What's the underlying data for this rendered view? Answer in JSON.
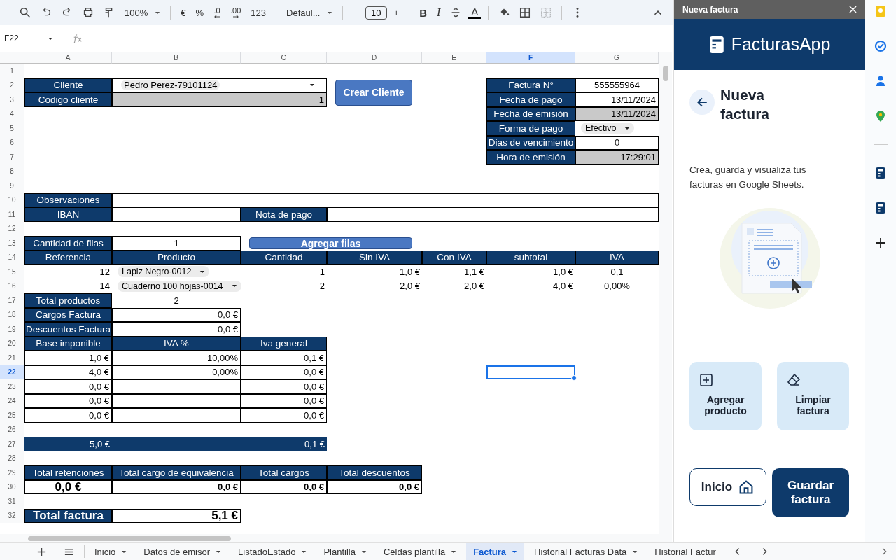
{
  "toolbar": [
    [
      {
        "kind": "search"
      },
      {
        "kind": "undo"
      },
      {
        "kind": "redo"
      },
      {
        "kind": "print"
      },
      {
        "kind": "paint-format"
      },
      {
        "kind": "dropdown",
        "text": "100%"
      }
    ],
    [
      {
        "kind": "text",
        "text": "€"
      },
      {
        "kind": "text",
        "text": "%"
      },
      {
        "kind": "decimal-less",
        "text": ".0"
      },
      {
        "kind": "decimal-more",
        "text": ".00"
      },
      {
        "kind": "text",
        "text": "123"
      }
    ],
    [
      {
        "kind": "dropdown",
        "text": "Defaul..."
      }
    ],
    [
      {
        "kind": "text",
        "text": "−"
      },
      {
        "kind": "field",
        "text": "10"
      },
      {
        "kind": "text",
        "text": "+"
      }
    ],
    [
      {
        "kind": "bold",
        "text": "B"
      },
      {
        "kind": "italic",
        "text": "I"
      },
      {
        "kind": "strikethrough"
      },
      {
        "kind": "text-color",
        "text": "A"
      }
    ],
    [
      {
        "kind": "fill-color"
      },
      {
        "kind": "borders"
      },
      {
        "kind": "merge",
        "disabled": true
      }
    ],
    [
      {
        "kind": "more"
      }
    ]
  ],
  "name_box": "F22",
  "sheet": {
    "columns": [
      "A",
      "B",
      "C",
      "D",
      "E",
      "F",
      "G"
    ],
    "row_numbers": [
      "1",
      "2",
      "3",
      "4",
      "5",
      "6",
      "7",
      "8",
      "9",
      "10",
      "11",
      "12",
      "13",
      "14",
      "15",
      "16",
      "17",
      "18",
      "19",
      "20",
      "21",
      "22",
      "23",
      "24",
      "25",
      "26",
      "27",
      "28",
      "29",
      "30",
      "31",
      "32"
    ],
    "cells": [
      {
        "kind": "label",
        "text": "Cliente"
      },
      {
        "kind": "dropdown",
        "text": "Pedro Perez-79101124"
      },
      {
        "kind": "button",
        "text": "Crear Cliente"
      },
      {
        "kind": "label",
        "text": "Factura N°"
      },
      {
        "kind": "value",
        "text": "555555964"
      },
      {
        "kind": "label",
        "text": "Codigo cliente"
      },
      {
        "kind": "readonly",
        "text": "1"
      },
      {
        "kind": "label",
        "text": "Fecha de pago"
      },
      {
        "kind": "value",
        "text": "13/11/2024"
      },
      {
        "kind": "label",
        "text": "Fecha de emisión"
      },
      {
        "kind": "readonly",
        "text": "13/11/2024"
      },
      {
        "kind": "label",
        "text": "Forma de pago"
      },
      {
        "kind": "chip",
        "text": "Efectivo"
      },
      {
        "kind": "label",
        "text": "Dias de vencimiento"
      },
      {
        "kind": "value",
        "text": "0"
      },
      {
        "kind": "label",
        "text": "Hora de emisión"
      },
      {
        "kind": "readonly",
        "text": "17:29:01"
      },
      {
        "kind": "label",
        "text": "Observaciones"
      },
      {
        "kind": "value"
      },
      {
        "kind": "label",
        "text": "IBAN"
      },
      {
        "kind": "value"
      },
      {
        "kind": "label",
        "text": "Nota de pago"
      },
      {
        "kind": "value"
      },
      {
        "kind": "label",
        "text": "Cantidad de filas"
      },
      {
        "kind": "value",
        "text": "1"
      },
      {
        "kind": "button",
        "text": "Agregar filas"
      },
      {
        "kind": "label",
        "text": "Referencia"
      },
      {
        "kind": "label",
        "text": "Producto"
      },
      {
        "kind": "label",
        "text": "Cantidad"
      },
      {
        "kind": "label",
        "text": "Sin IVA"
      },
      {
        "kind": "label",
        "text": "Con IVA"
      },
      {
        "kind": "label",
        "text": "subtotal"
      },
      {
        "kind": "label",
        "text": "IVA"
      },
      {
        "kind": "plain",
        "text": "12"
      },
      {
        "kind": "chip",
        "text": "Lapiz Negro-0012"
      },
      {
        "kind": "plain",
        "text": "1"
      },
      {
        "kind": "plain",
        "text": "1,0 €"
      },
      {
        "kind": "plain",
        "text": "1,1 €"
      },
      {
        "kind": "plain",
        "text": "1,0 €"
      },
      {
        "kind": "plain",
        "text": "0,1"
      },
      {
        "kind": "plain",
        "text": "14"
      },
      {
        "kind": "chip",
        "text": "Cuaderno 100 hojas-0014"
      },
      {
        "kind": "plain",
        "text": "2"
      },
      {
        "kind": "plain",
        "text": "2,0 €"
      },
      {
        "kind": "plain",
        "text": "2,0 €"
      },
      {
        "kind": "plain",
        "text": "4,0 €"
      },
      {
        "kind": "plain",
        "text": "0,00%"
      },
      {
        "kind": "label",
        "text": "Total productos"
      },
      {
        "kind": "plain",
        "text": "2"
      },
      {
        "kind": "label",
        "text": "Cargos Factura"
      },
      {
        "kind": "value",
        "text": "0,0 €"
      },
      {
        "kind": "label",
        "text": "Descuentos Factura"
      },
      {
        "kind": "value",
        "text": "0,0 €"
      },
      {
        "kind": "label",
        "text": "Base imponible"
      },
      {
        "kind": "label",
        "text": "IVA %"
      },
      {
        "kind": "label",
        "text": "Iva general"
      },
      {
        "kind": "value",
        "text": "1,0 €"
      },
      {
        "kind": "value",
        "text": "10,00%"
      },
      {
        "kind": "value",
        "text": "0,1 €"
      },
      {
        "kind": "value",
        "text": "4,0 €"
      },
      {
        "kind": "value",
        "text": "0,00%"
      },
      {
        "kind": "value",
        "text": "0,0 €"
      },
      {
        "kind": "value",
        "text": "0,0 €"
      },
      {
        "kind": "value"
      },
      {
        "kind": "value",
        "text": "0,0 €"
      },
      {
        "kind": "value",
        "text": "0,0 €"
      },
      {
        "kind": "value"
      },
      {
        "kind": "value",
        "text": "0,0 €"
      },
      {
        "kind": "value",
        "text": "0,0 €"
      },
      {
        "kind": "value"
      },
      {
        "kind": "value",
        "text": "0,0 €"
      },
      {
        "kind": "total",
        "text": "5,0 €"
      },
      {
        "kind": "total",
        "text": "0,1 €"
      },
      {
        "kind": "label",
        "text": "Total retenciones"
      },
      {
        "kind": "label",
        "text": "Total cargo de equivalencia"
      },
      {
        "kind": "label",
        "text": "Total cargos"
      },
      {
        "kind": "label",
        "text": "Total descuentos"
      },
      {
        "kind": "value-large",
        "text": "0,0 €"
      },
      {
        "kind": "value-bold",
        "text": "0,0 €"
      },
      {
        "kind": "value-bold",
        "text": "0,0 €"
      },
      {
        "kind": "value-bold",
        "text": "0,0 €"
      },
      {
        "kind": "label-large",
        "text": "Total factura"
      },
      {
        "kind": "value-large",
        "text": "5,1 €"
      }
    ]
  },
  "panel": {
    "title": "Nueva factura",
    "brand": "FacturasApp",
    "heading": "Nueva factura",
    "description": "Crea, guarda y visualiza tus facturas en Google Sheets.",
    "actions": [
      {
        "kind": "add",
        "label": "Agregar producto"
      },
      {
        "kind": "clear",
        "label": "Limpiar factura"
      }
    ],
    "buttons": [
      {
        "kind": "secondary",
        "label": "Inicio"
      },
      {
        "kind": "primary",
        "label": "Guardar factura"
      }
    ]
  },
  "rail": [
    {
      "kind": "keep"
    },
    {
      "kind": "tasks"
    },
    {
      "kind": "contacts"
    },
    {
      "kind": "maps"
    },
    {
      "kind": "divider"
    },
    {
      "kind": "addon"
    },
    {
      "kind": "addon"
    },
    {
      "kind": "add"
    }
  ],
  "sheet_tabs": [
    {
      "label": "Inicio",
      "selected": false
    },
    {
      "label": "Datos de emisor",
      "selected": false
    },
    {
      "label": "ListadoEstado",
      "selected": false
    },
    {
      "label": "Plantilla",
      "selected": false
    },
    {
      "label": "Celdas plantilla",
      "selected": false
    },
    {
      "label": "Factura",
      "selected": true
    },
    {
      "label": "Historial Facturas Data",
      "selected": false
    },
    {
      "label": "Historial Factur",
      "selected": false
    }
  ]
}
